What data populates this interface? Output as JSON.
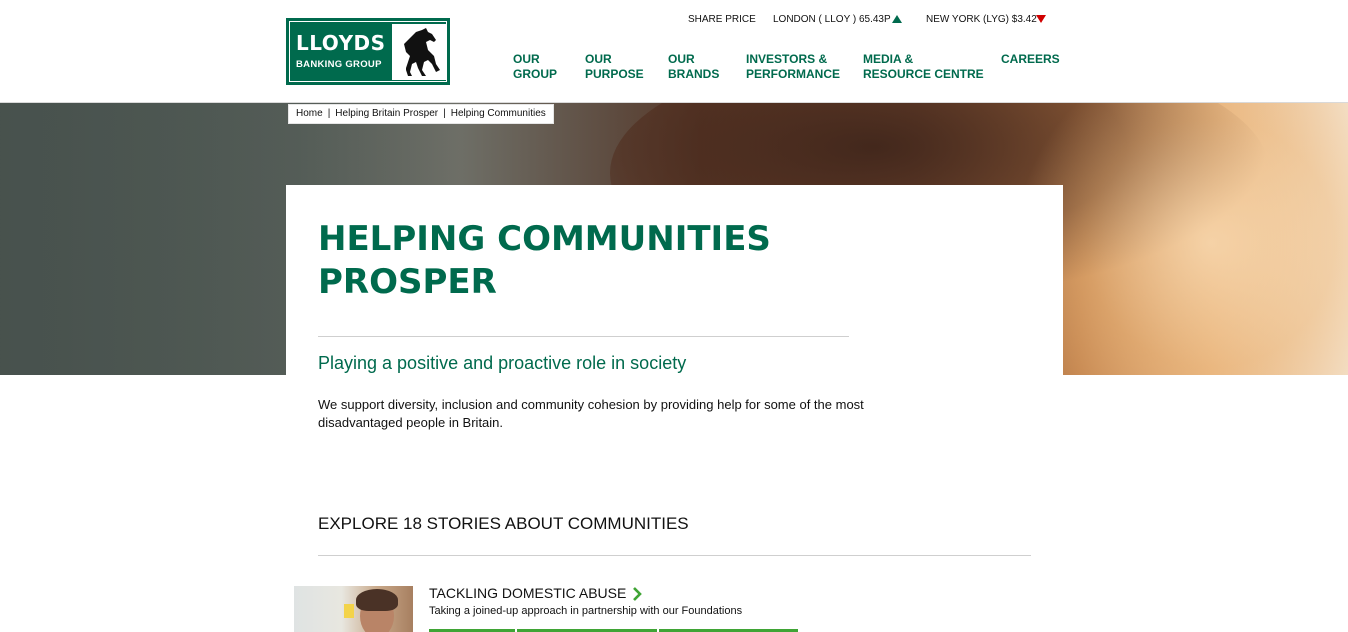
{
  "logo": {
    "title": "LLOYDS",
    "subtitle": "BANKING GROUP",
    "icon": "black-horse-icon"
  },
  "share": {
    "label": "SHARE PRICE",
    "london": "LONDON ( LLOY ) 65.43P",
    "london_trend": "up",
    "newyork": "NEW YORK (LYG) $3.42",
    "newyork_trend": "down",
    "up_color": "#006a4d",
    "down_color": "#d00000"
  },
  "nav": [
    {
      "line1": "OUR",
      "line2": "GROUP"
    },
    {
      "line1": "OUR",
      "line2": "PURPOSE"
    },
    {
      "line1": "OUR",
      "line2": "BRANDS"
    },
    {
      "line1": "INVESTORS &",
      "line2": "PERFORMANCE"
    },
    {
      "line1": "MEDIA &",
      "line2": "RESOURCE CENTRE"
    },
    {
      "line1": "CAREERS",
      "line2": ""
    }
  ],
  "breadcrumb": [
    "Home",
    "Helping Britain Prosper",
    "Helping Communities"
  ],
  "hero": {
    "title_line1": "HELPING COMMUNITIES",
    "title_line2": "PROSPER",
    "subtitle": "Playing a positive and proactive role in society",
    "intro": "We support diversity, inclusion and community cohesion by providing help for some of the most disadvantaged people in Britain."
  },
  "explore": {
    "heading": "EXPLORE 18 STORIES ABOUT COMMUNITIES"
  },
  "stories": [
    {
      "title": "TACKLING DOMESTIC ABUSE",
      "description": "Taking a joined-up approach in partnership with our Foundations",
      "icon": "chevron-right-icon"
    }
  ],
  "colors": {
    "brand_green": "#006a4d",
    "accent_green": "#3fa435"
  }
}
